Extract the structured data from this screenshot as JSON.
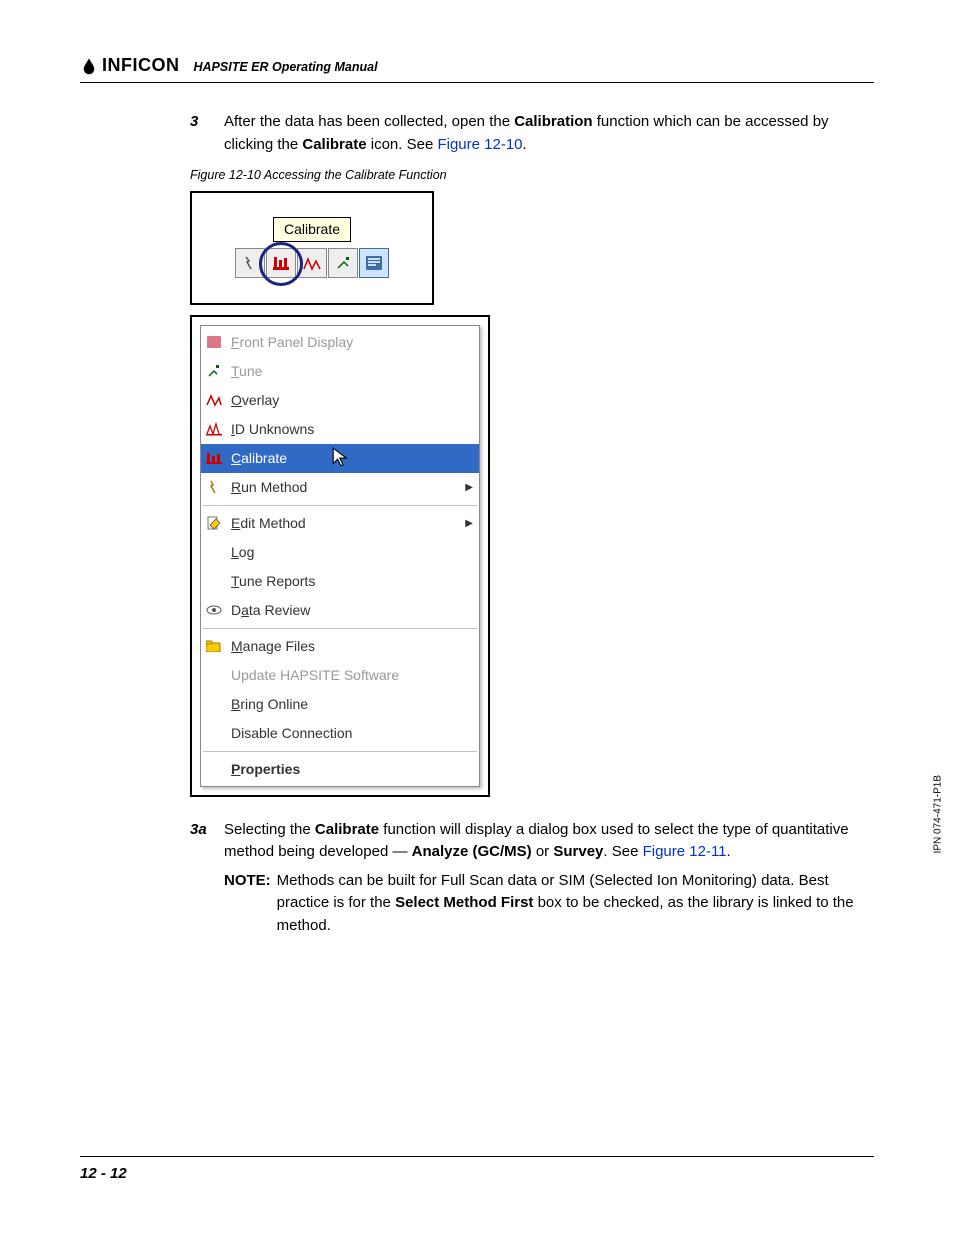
{
  "brand": "INFICON",
  "manual_title": "HAPSITE ER Operating Manual",
  "side_code": "IPN 074-471-P1B",
  "page_number": "12 - 12",
  "step3": {
    "num": "3",
    "text_before": "After the data has been collected, open the ",
    "bold1": "Calibration",
    "text_mid": " function which can be accessed by clicking the ",
    "bold2": "Calibrate",
    "text_after": " icon. See ",
    "link": "Figure 12-10",
    "period": "."
  },
  "fig_caption": "Figure 12-10  Accessing the Calibrate Function",
  "toolbar": {
    "tooltip": "Calibrate",
    "icons": [
      "run-icon",
      "calibrate-icon",
      "overlay-icon",
      "tune-icon",
      "panel-icon"
    ]
  },
  "menu": {
    "items": [
      {
        "label": "Front Panel Display",
        "accel": "F",
        "icon": "panel",
        "disabled": true
      },
      {
        "label": "Tune",
        "accel": "T",
        "icon": "tune",
        "disabled": true
      },
      {
        "label": "Overlay",
        "accel": "O",
        "icon": "overlay"
      },
      {
        "label": "ID Unknowns",
        "accel": "I",
        "icon": "id"
      },
      {
        "label": "Calibrate",
        "accel": "C",
        "icon": "calib",
        "selected": true
      },
      {
        "label": "Run Method",
        "accel": "R",
        "icon": "run",
        "submenu": true
      },
      {
        "sep": true
      },
      {
        "label": "Edit Method",
        "accel": "E",
        "icon": "edit",
        "submenu": true
      },
      {
        "label": "Log",
        "accel": "L",
        "icon": ""
      },
      {
        "label": "Tune Reports",
        "accel": "T",
        "icon": ""
      },
      {
        "label": "Data Review",
        "accel": "a",
        "icon": "review"
      },
      {
        "sep": true
      },
      {
        "label": "Manage Files",
        "accel": "M",
        "icon": "files"
      },
      {
        "label": "Update HAPSITE Software",
        "accel": "",
        "icon": "",
        "disabled": true
      },
      {
        "label": "Bring Online",
        "accel": "B",
        "icon": ""
      },
      {
        "label": "Disable Connection",
        "accel": "",
        "icon": ""
      },
      {
        "sep": true
      },
      {
        "label": "Properties",
        "accel": "P",
        "icon": "",
        "bold": true
      }
    ]
  },
  "step3a": {
    "num": "3a",
    "t1": "Selecting the ",
    "b1": "Calibrate",
    "t2": " function will display a dialog box used to select the type of quantitative method being developed — ",
    "b2": "Analyze (GC/MS)",
    "t3": " or ",
    "b3": "Survey",
    "t4": ". See ",
    "link": "Figure 12-11",
    "period": "."
  },
  "note": {
    "label": "NOTE:",
    "t1": "Methods can be built for Full Scan data or SIM (Selected Ion Monitoring) data. Best practice is for the ",
    "b1": "Select Method First",
    "t2": " box to be checked, as the library is linked to the method."
  }
}
